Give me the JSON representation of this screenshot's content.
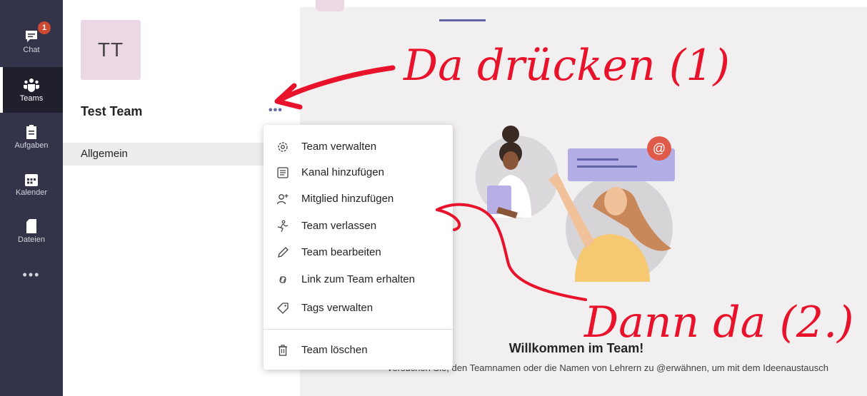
{
  "rail": {
    "items": [
      {
        "label": "Chat",
        "icon": "chat-icon",
        "badge": "1"
      },
      {
        "label": "Teams",
        "icon": "teams-icon",
        "active": true
      },
      {
        "label": "Aufgaben",
        "icon": "tasks-icon"
      },
      {
        "label": "Kalender",
        "icon": "calendar-icon"
      },
      {
        "label": "Dateien",
        "icon": "files-icon"
      }
    ],
    "more_label": "•••"
  },
  "team": {
    "avatar_initials": "TT",
    "name": "Test Team",
    "more_button": "•••",
    "channels": [
      "Allgemein"
    ]
  },
  "menu": {
    "items": [
      {
        "label": "Team verwalten",
        "icon": "gear-icon"
      },
      {
        "label": "Kanal hinzufügen",
        "icon": "channel-icon"
      },
      {
        "label": "Mitglied hinzufügen",
        "icon": "add-member-icon"
      },
      {
        "label": "Team verlassen",
        "icon": "leave-icon"
      },
      {
        "label": "Team bearbeiten",
        "icon": "pencil-icon"
      },
      {
        "label": "Link zum Team erhalten",
        "icon": "link-icon"
      },
      {
        "label": "Tags verwalten",
        "icon": "tag-icon"
      },
      {
        "label": "Team löschen",
        "icon": "trash-icon"
      }
    ]
  },
  "welcome": {
    "title": "Willkommen im Team!",
    "subtitle": "Versuchen Sie, den Teamnamen oder die Namen von Lehrern zu @erwähnen, um mit dem Ideenaustausch"
  },
  "annotations": {
    "step1": "Da drücken (1)",
    "step2": "Dann da (2.)"
  },
  "colors": {
    "rail_bg": "#33344a",
    "accent": "#6264a7",
    "annotation_red": "#e8132a",
    "badge": "#cc4a31"
  }
}
